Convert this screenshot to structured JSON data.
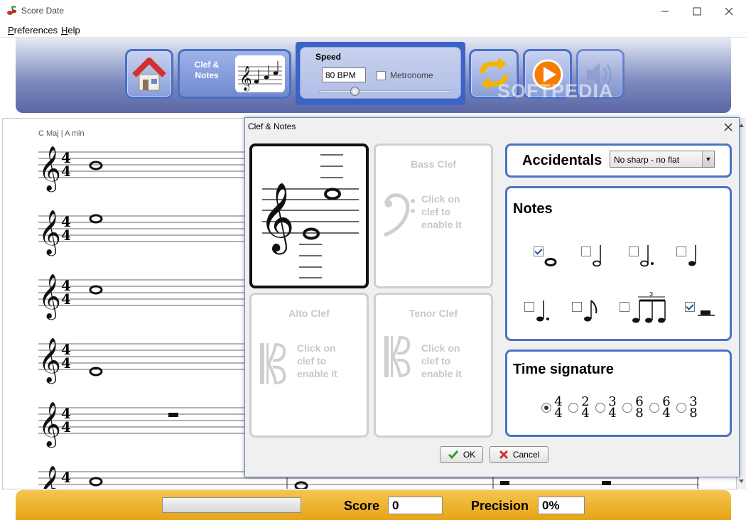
{
  "window": {
    "title": "Score Date"
  },
  "menu": [
    {
      "first": "P",
      "rest": "references"
    },
    {
      "first": "H",
      "rest": "elp"
    }
  ],
  "toolbar": {
    "clef_notes_label": "Clef & Notes",
    "speed": {
      "title": "Speed",
      "bpm": "80 BPM",
      "metronome_label": "Metronome",
      "metronome_checked": false,
      "slider_level": 0.27
    },
    "watermark": "SOFTPEDIA"
  },
  "score": {
    "key_signature": "C Maj | A min",
    "time_signature": [
      "4",
      "4"
    ]
  },
  "bottom": {
    "score_label": "Score",
    "score_value": "0",
    "precision_label": "Precision",
    "precision_value": "0%"
  },
  "dialog": {
    "title": "Clef & Notes",
    "clefs": [
      {
        "name": "Treble Clef",
        "active": true
      },
      {
        "name": "Bass Clef",
        "active": false,
        "hint": [
          "Click on",
          "clef to",
          "enable it"
        ]
      },
      {
        "name": "Alto Clef",
        "active": false,
        "hint": [
          "Click on",
          "clef to",
          "enable it"
        ]
      },
      {
        "name": "Tenor Clef",
        "active": false,
        "hint": [
          "Click on",
          "clef to",
          "enable it"
        ]
      }
    ],
    "accidentals": {
      "label": "Accidentals",
      "selected": "No sharp - no flat"
    },
    "notes": {
      "label": "Notes",
      "items": [
        {
          "name": "whole",
          "checked": true
        },
        {
          "name": "half",
          "checked": false
        },
        {
          "name": "dotted-half",
          "checked": false
        },
        {
          "name": "quarter",
          "checked": false
        },
        {
          "name": "dotted-quarter",
          "checked": false
        },
        {
          "name": "eighth",
          "checked": false
        },
        {
          "name": "triplet",
          "checked": false
        },
        {
          "name": "rest",
          "checked": true
        }
      ],
      "triplet_number": "3"
    },
    "time_signature": {
      "label": "Time signature",
      "options": [
        {
          "top": "4",
          "bottom": "4",
          "selected": true
        },
        {
          "top": "2",
          "bottom": "4",
          "selected": false
        },
        {
          "top": "3",
          "bottom": "4",
          "selected": false
        },
        {
          "top": "6",
          "bottom": "8",
          "selected": false
        },
        {
          "top": "6",
          "bottom": "4",
          "selected": false
        },
        {
          "top": "3",
          "bottom": "8",
          "selected": false
        }
      ]
    },
    "ok_label": "OK",
    "cancel_label": "Cancel"
  }
}
